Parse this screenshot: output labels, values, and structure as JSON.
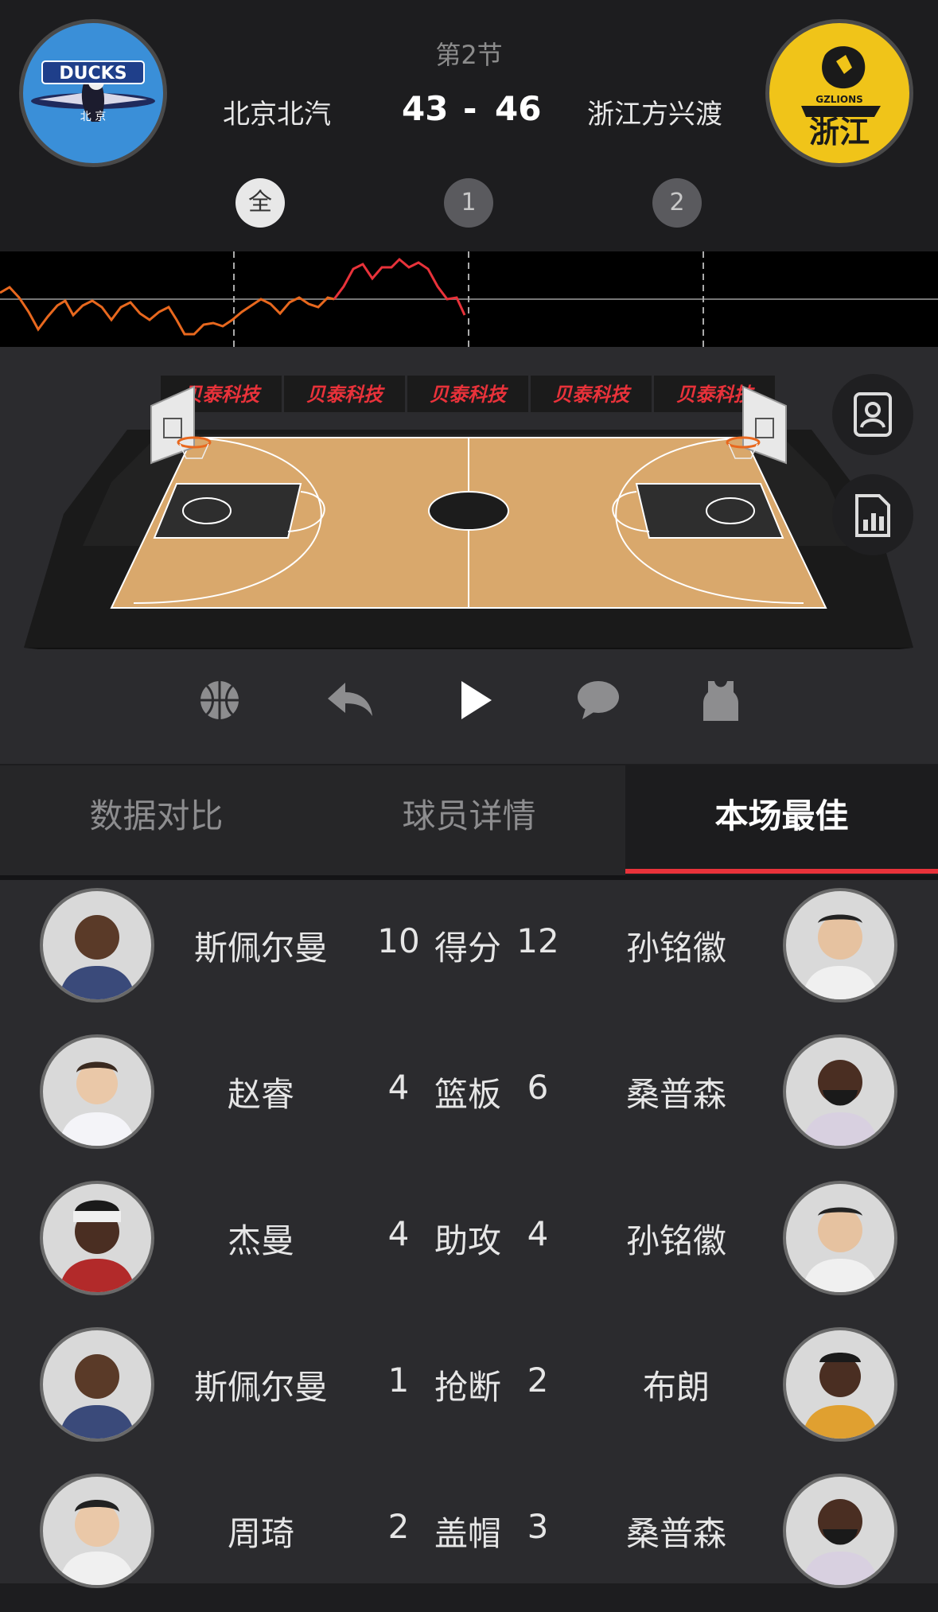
{
  "game": {
    "period": "第2节",
    "home_team": "北京北汽",
    "away_team": "浙江方兴渡",
    "home_score": "43",
    "score_separator": "-",
    "away_score": "46",
    "home_logo_text": "DUCKS",
    "home_logo_sub": "北  京",
    "away_logo_top": "GZLIONS",
    "away_logo_main": "浙江"
  },
  "quarter_buttons": [
    {
      "label": "全",
      "active": true
    },
    {
      "label": "1",
      "active": false
    },
    {
      "label": "2",
      "active": false
    }
  ],
  "court": {
    "sponsor_text": "贝泰科技"
  },
  "side_buttons": [
    "player-card-icon",
    "stats-chart-icon"
  ],
  "controls": [
    "basketball-icon",
    "undo-icon",
    "play-icon",
    "chat-icon",
    "jersey-icon"
  ],
  "tabs": [
    {
      "label": "数据对比",
      "active": false
    },
    {
      "label": "球员详情",
      "active": false
    },
    {
      "label": "本场最佳",
      "active": true
    }
  ],
  "best_players": [
    {
      "left_name": "斯佩尔曼",
      "left_value": "10",
      "stat": "得分",
      "right_value": "12",
      "right_name": "孙铭徽"
    },
    {
      "left_name": "赵睿",
      "left_value": "4",
      "stat": "篮板",
      "right_value": "6",
      "right_name": "桑普森"
    },
    {
      "left_name": "杰曼",
      "left_value": "4",
      "stat": "助攻",
      "right_value": "4",
      "right_name": "孙铭徽"
    },
    {
      "left_name": "斯佩尔曼",
      "left_value": "1",
      "stat": "抢断",
      "right_value": "2",
      "right_name": "布朗"
    },
    {
      "left_name": "周琦",
      "left_value": "2",
      "stat": "盖帽",
      "right_value": "3",
      "right_name": "桑普森"
    }
  ],
  "colors": {
    "accent_red": "#e8323a",
    "trend_orange": "#e8681e",
    "trend_red": "#e8323a"
  }
}
